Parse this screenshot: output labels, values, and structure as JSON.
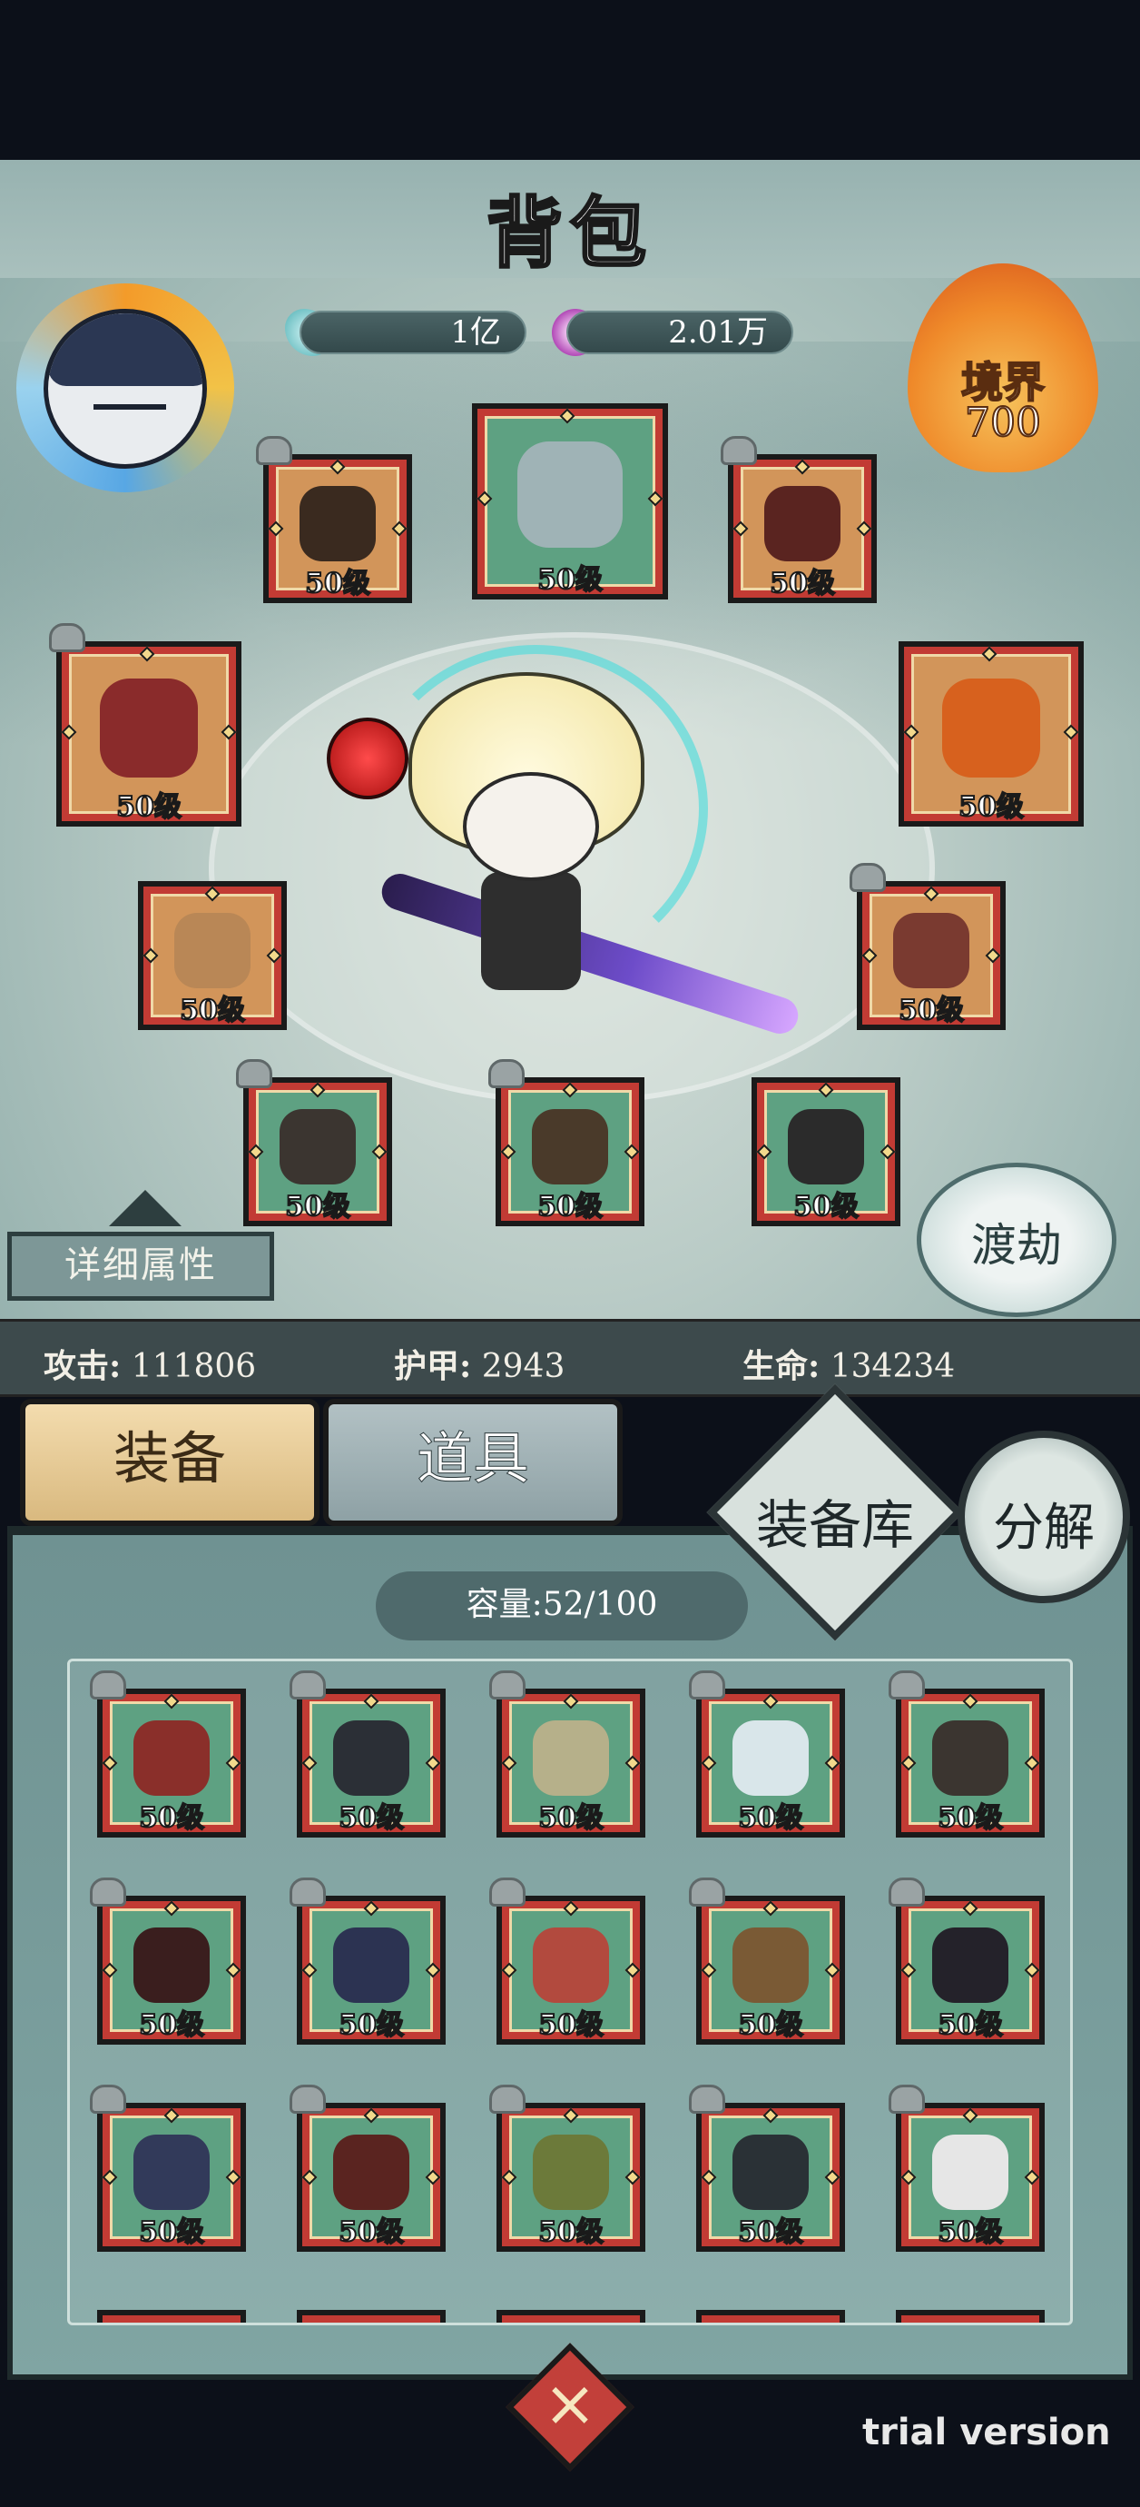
{
  "title": "背包",
  "currency": [
    {
      "icon": "crystal-icon",
      "value": "1亿",
      "color": "#7fd3d6"
    },
    {
      "icon": "swirl-coin-icon",
      "value": "2.01万",
      "color": "#c45cc9"
    }
  ],
  "realm": {
    "label": "境界",
    "value": "700"
  },
  "equipped": [
    {
      "id": "ring-top-left",
      "level": "50级",
      "frame": "orange",
      "art": "#3a2a1f",
      "icon": "ring-icon",
      "locked": true
    },
    {
      "id": "necklace",
      "level": "50级",
      "frame": "green",
      "art": "#9fb3b6",
      "icon": "necklace-icon",
      "locked": false
    },
    {
      "id": "glove",
      "level": "50级",
      "frame": "orange",
      "art": "#5a2420",
      "icon": "glove-icon",
      "locked": true
    },
    {
      "id": "feather",
      "level": "50级",
      "frame": "orange",
      "art": "#8a2b2b",
      "icon": "feather-icon",
      "locked": true
    },
    {
      "id": "swirl-charm",
      "level": "50级",
      "frame": "orange",
      "art": "#d7611e",
      "icon": "swirl-charm-icon",
      "locked": false
    },
    {
      "id": "hat",
      "level": "50级",
      "frame": "orange",
      "art": "#b98756",
      "icon": "hat-icon",
      "locked": false
    },
    {
      "id": "shoulder",
      "level": "50级",
      "frame": "orange",
      "art": "#7a3a30",
      "icon": "shoulder-icon",
      "locked": true
    },
    {
      "id": "robe",
      "level": "50级",
      "frame": "green",
      "art": "#3b3530",
      "icon": "robe-icon",
      "locked": true
    },
    {
      "id": "boots",
      "level": "50级",
      "frame": "green",
      "art": "#4a3a2a",
      "icon": "boots-icon",
      "locked": true
    },
    {
      "id": "skirt",
      "level": "50级",
      "frame": "green",
      "art": "#2b2b2b",
      "icon": "skirt-icon",
      "locked": false
    }
  ],
  "detail_button": "详细属性",
  "dujie_button": "渡劫",
  "stats": [
    {
      "label": "攻击:",
      "value": "111806"
    },
    {
      "label": "护甲:",
      "value": "2943"
    },
    {
      "label": "生命:",
      "value": "134234"
    }
  ],
  "tabs": [
    {
      "label": "装备",
      "active": true
    },
    {
      "label": "道具",
      "active": false
    }
  ],
  "warehouse_button": "装备库",
  "decompose_button": "分解",
  "capacity": "容量:52/100",
  "bag_items": [
    {
      "level": "50级",
      "art": "#8a2f2a",
      "icon": "horned-helmet-icon"
    },
    {
      "level": "50级",
      "art": "#2b2f36",
      "icon": "sword-icon"
    },
    {
      "level": "50级",
      "art": "#b6b08a",
      "icon": "light-robe-icon"
    },
    {
      "level": "50级",
      "art": "#d9e6ea",
      "icon": "fur-coat-icon"
    },
    {
      "level": "50级",
      "art": "#3b3530",
      "icon": "bead-robe-icon"
    },
    {
      "level": "50级",
      "art": "#3a1e1e",
      "icon": "dark-robe-icon"
    },
    {
      "level": "50级",
      "art": "#2c3352",
      "icon": "blue-coat-icon"
    },
    {
      "level": "50级",
      "art": "#b24a3e",
      "icon": "red-hat-icon"
    },
    {
      "level": "50级",
      "art": "#7a5a35",
      "icon": "bracer-icon"
    },
    {
      "level": "50级",
      "art": "#24222a",
      "icon": "horn-icon"
    },
    {
      "level": "50级",
      "art": "#323a5a",
      "icon": "bracer-blue-icon"
    },
    {
      "level": "50级",
      "art": "#5a2420",
      "icon": "red-glove-icon"
    },
    {
      "level": "50级",
      "art": "#6c7a3a",
      "icon": "green-robe-icon"
    },
    {
      "level": "50级",
      "art": "#2a3136",
      "icon": "dark-armor-icon"
    },
    {
      "level": "50级",
      "art": "#e6e6e6",
      "icon": "white-coat-icon"
    }
  ],
  "close_button": "×",
  "watermark": "trial version"
}
